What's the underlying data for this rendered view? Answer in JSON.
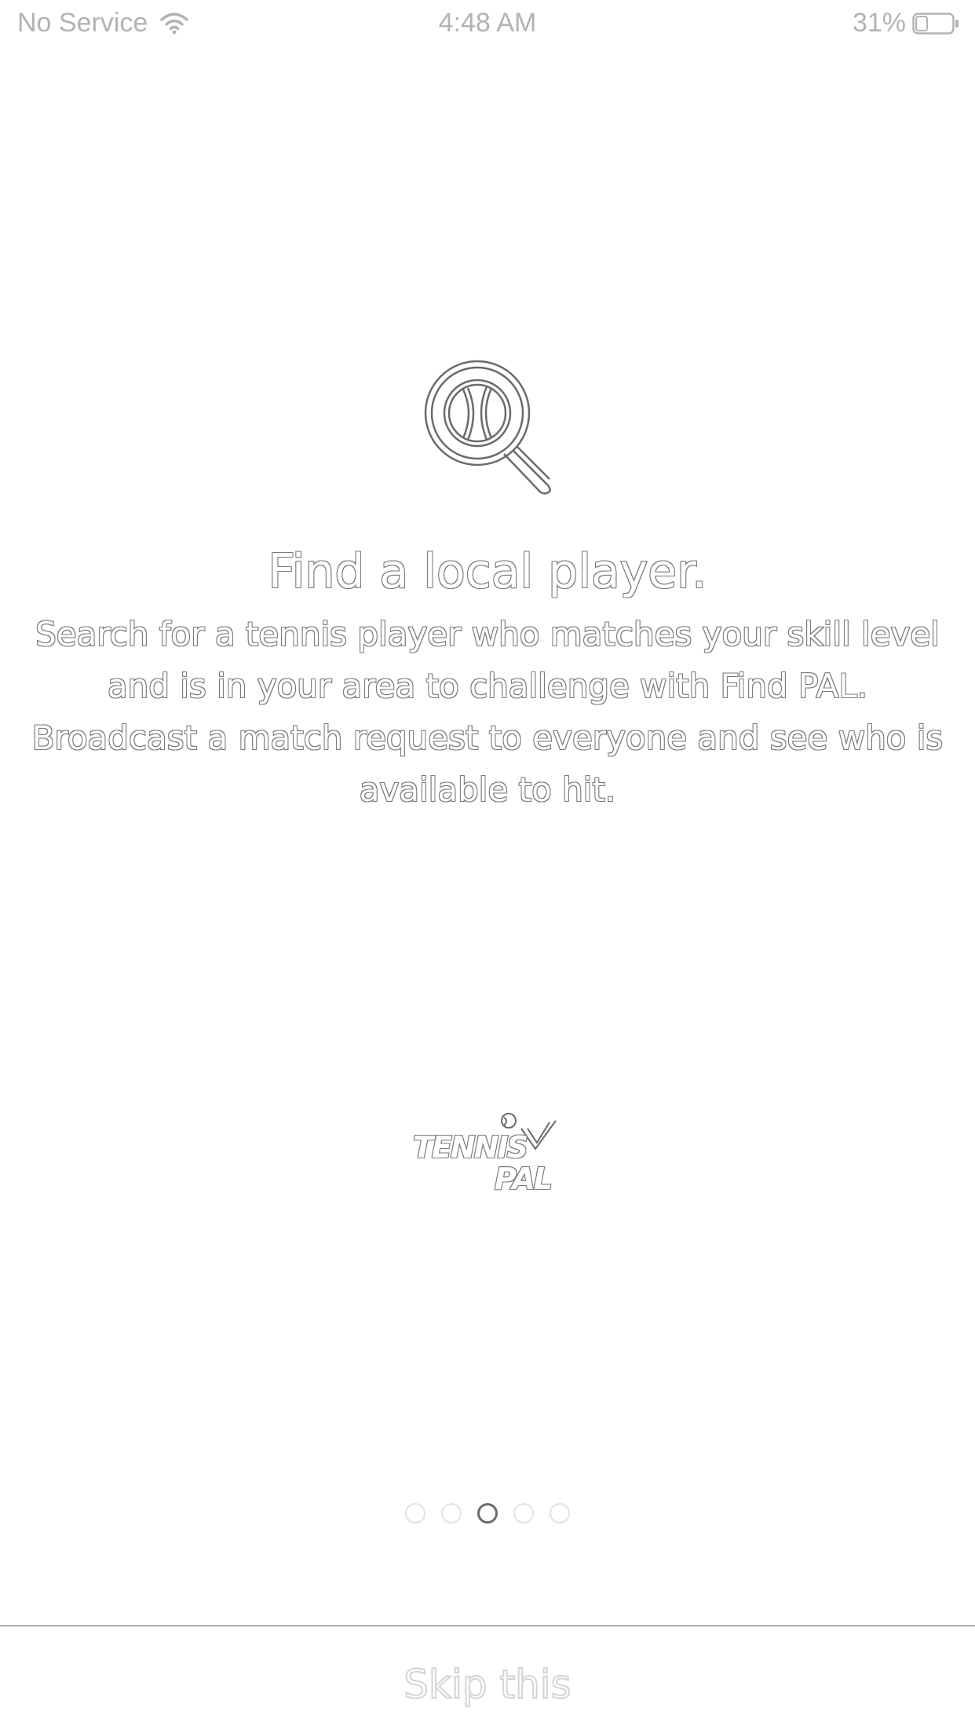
{
  "status_bar": {
    "carrier": "No Service",
    "time": "4:48 AM",
    "battery_percent": "31%",
    "wifi_icon": "wifi-icon",
    "battery_icon": "battery-icon",
    "battery_level": 0.31
  },
  "onboarding": {
    "icon": "magnifier-tennis-ball-icon",
    "title": "Find a local player.",
    "description_line1": "Search for a tennis player who matches your skill level",
    "description_line2": "and is in your area to challenge with Find PAL.",
    "description_line3": "Broadcast a match request to everyone and see who is",
    "description_line4": "available to hit."
  },
  "logo": {
    "word1": "TENNIS",
    "word2": "PAL"
  },
  "pagination": {
    "total": 5,
    "current": 3
  },
  "footer": {
    "skip_label": "Skip this"
  },
  "colors": {
    "outline": "#6b6b6b",
    "status_text": "#b3b3b3",
    "divider": "#a9a9b0"
  }
}
